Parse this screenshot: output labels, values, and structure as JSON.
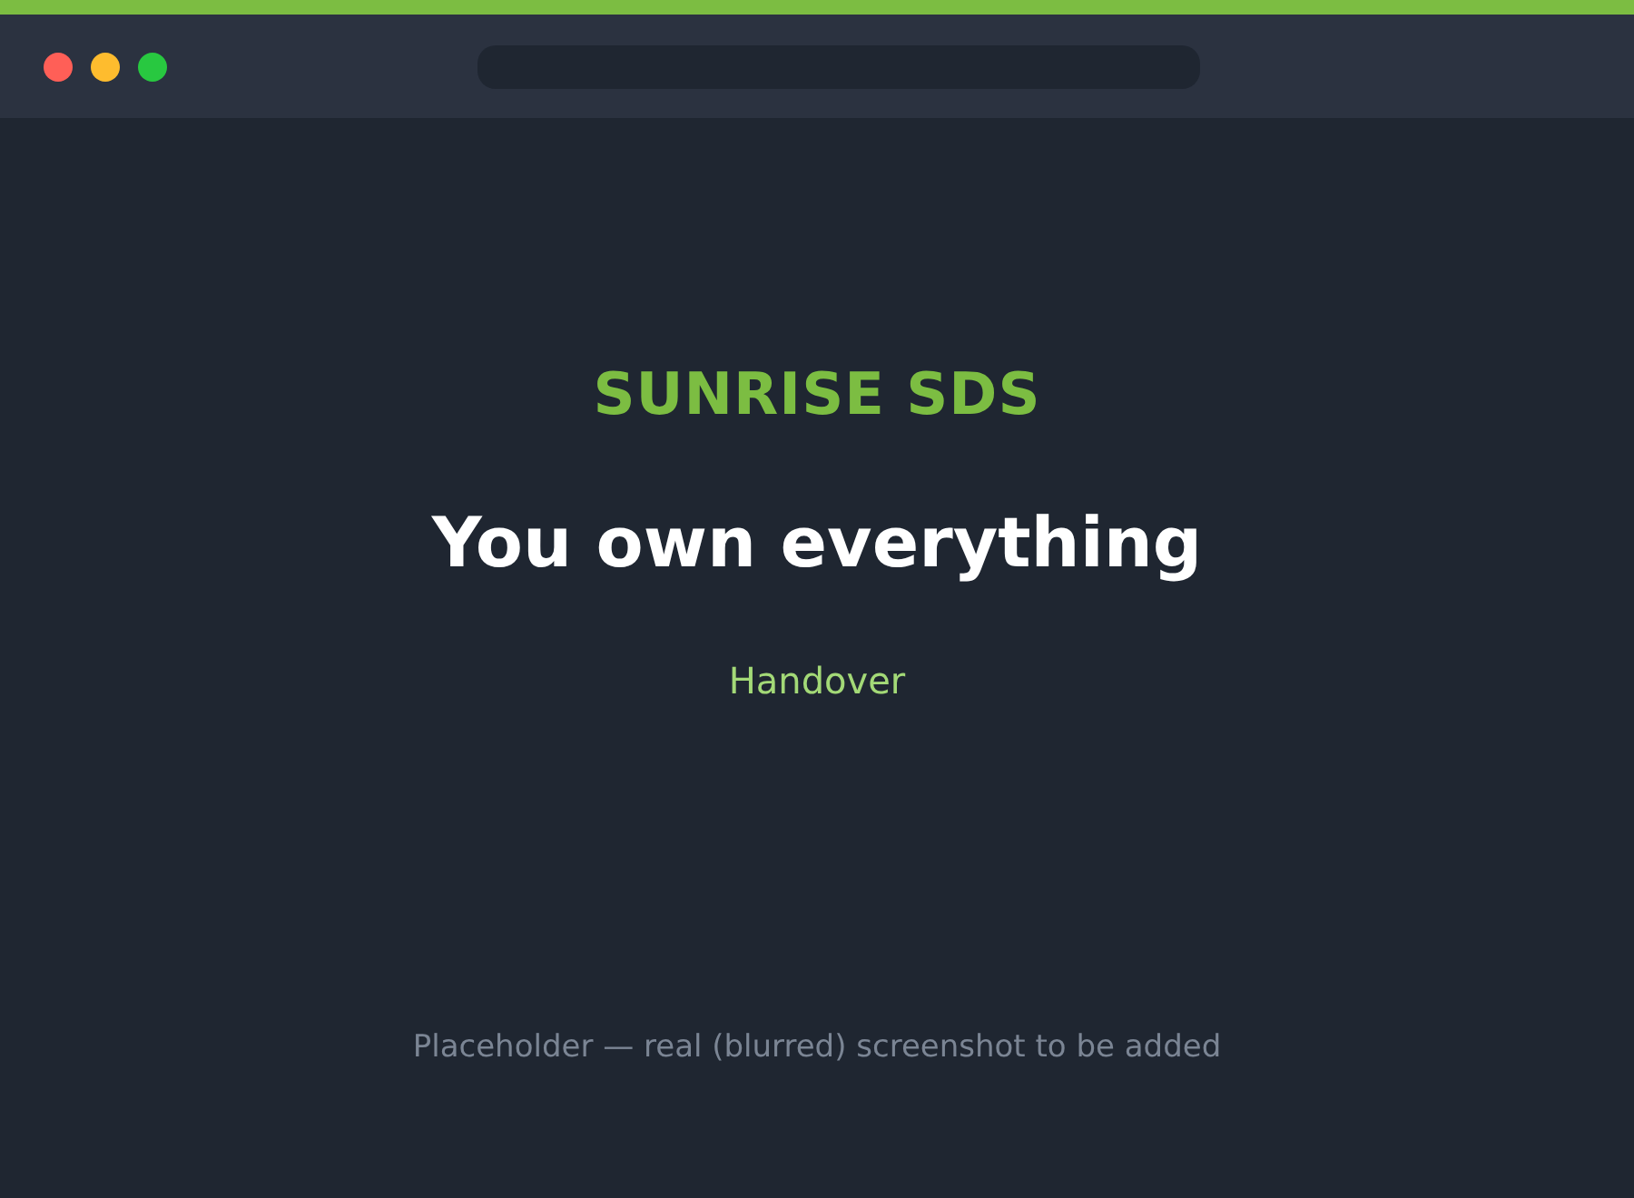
{
  "brand": "SUNRISE SDS",
  "headline": "You own everything",
  "subtitle": "Handover",
  "note": "Placeholder — real (blurred) screenshot to be added"
}
